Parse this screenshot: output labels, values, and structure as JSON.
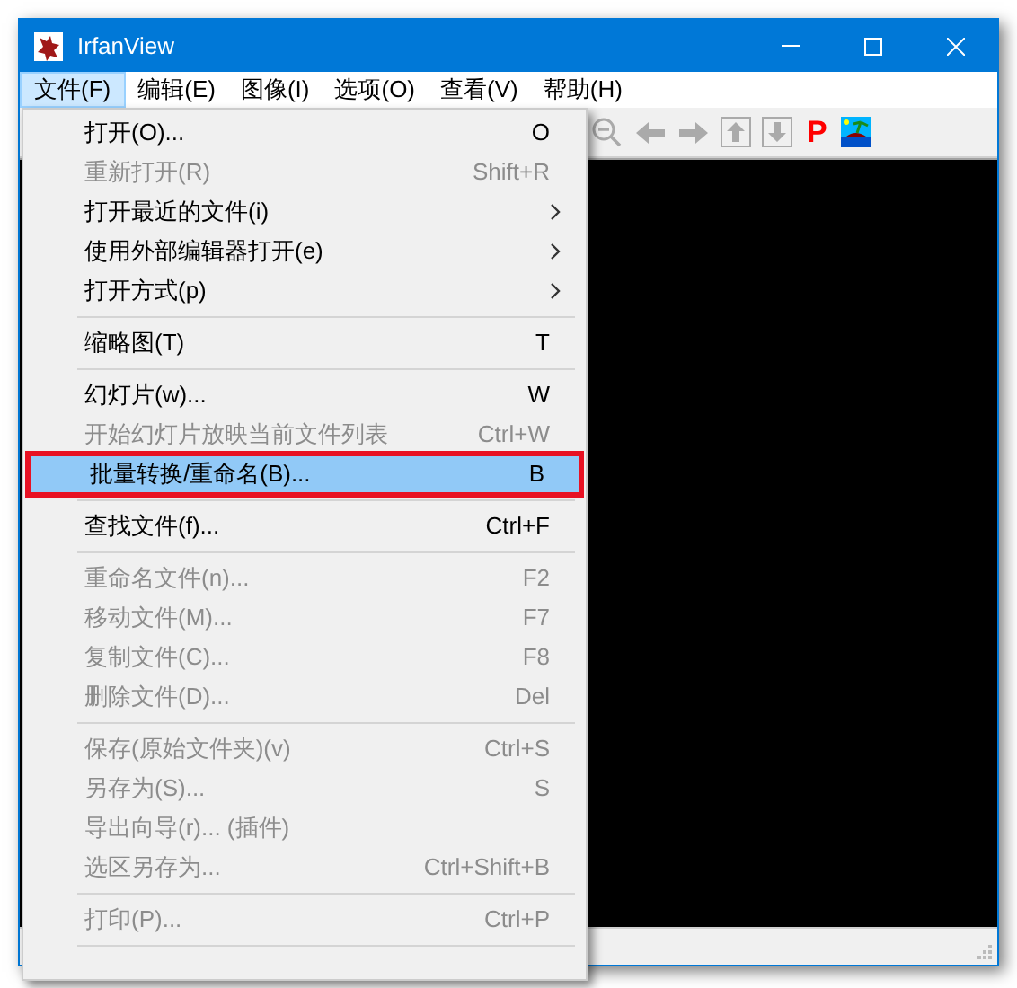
{
  "window": {
    "title": "IrfanView"
  },
  "menubar": [
    {
      "label": "文件(F)",
      "selected": true
    },
    {
      "label": "编辑(E)",
      "selected": false
    },
    {
      "label": "图像(I)",
      "selected": false
    },
    {
      "label": "选项(O)",
      "selected": false
    },
    {
      "label": "查看(V)",
      "selected": false
    },
    {
      "label": "帮助(H)",
      "selected": false
    }
  ],
  "menu": [
    {
      "kind": "item",
      "label": "打开(O)...",
      "shortcut": "O",
      "disabled": false,
      "submenu": false,
      "selected": false,
      "annotated": false
    },
    {
      "kind": "item",
      "label": "重新打开(R)",
      "shortcut": "Shift+R",
      "disabled": true,
      "submenu": false,
      "selected": false,
      "annotated": false
    },
    {
      "kind": "item",
      "label": "打开最近的文件(i)",
      "disabled": false,
      "submenu": true,
      "selected": false,
      "annotated": false
    },
    {
      "kind": "item",
      "label": "使用外部编辑器打开(e)",
      "disabled": false,
      "submenu": true,
      "selected": false,
      "annotated": false
    },
    {
      "kind": "item",
      "label": "打开方式(p)",
      "disabled": false,
      "submenu": true,
      "selected": false,
      "annotated": false
    },
    {
      "kind": "separator"
    },
    {
      "kind": "item",
      "label": "缩略图(T)",
      "shortcut": "T",
      "disabled": false,
      "submenu": false,
      "selected": false,
      "annotated": false
    },
    {
      "kind": "separator"
    },
    {
      "kind": "item",
      "label": "幻灯片(w)...",
      "shortcut": "W",
      "disabled": false,
      "submenu": false,
      "selected": false,
      "annotated": false
    },
    {
      "kind": "item",
      "label": "开始幻灯片放映当前文件列表",
      "shortcut": "Ctrl+W",
      "disabled": true,
      "submenu": false,
      "selected": false,
      "annotated": false
    },
    {
      "kind": "item",
      "label": "批量转换/重命名(B)...",
      "shortcut": "B",
      "disabled": false,
      "submenu": false,
      "selected": true,
      "annotated": true
    },
    {
      "kind": "separator"
    },
    {
      "kind": "item",
      "label": "查找文件(f)...",
      "shortcut": "Ctrl+F",
      "disabled": false,
      "submenu": false,
      "selected": false,
      "annotated": false
    },
    {
      "kind": "separator"
    },
    {
      "kind": "item",
      "label": "重命名文件(n)...",
      "shortcut": "F2",
      "disabled": true,
      "submenu": false,
      "selected": false,
      "annotated": false
    },
    {
      "kind": "item",
      "label": "移动文件(M)...",
      "shortcut": "F7",
      "disabled": true,
      "submenu": false,
      "selected": false,
      "annotated": false
    },
    {
      "kind": "item",
      "label": "复制文件(C)...",
      "shortcut": "F8",
      "disabled": true,
      "submenu": false,
      "selected": false,
      "annotated": false
    },
    {
      "kind": "item",
      "label": "删除文件(D)...",
      "shortcut": "Del",
      "disabled": true,
      "submenu": false,
      "selected": false,
      "annotated": false
    },
    {
      "kind": "separator"
    },
    {
      "kind": "item",
      "label": "保存(原始文件夹)(v)",
      "shortcut": "Ctrl+S",
      "disabled": true,
      "submenu": false,
      "selected": false,
      "annotated": false
    },
    {
      "kind": "item",
      "label": "另存为(S)...",
      "shortcut": "S",
      "disabled": true,
      "submenu": false,
      "selected": false,
      "annotated": false
    },
    {
      "kind": "item",
      "label": "导出向导(r)... (插件)",
      "disabled": true,
      "submenu": false,
      "selected": false,
      "annotated": false
    },
    {
      "kind": "item",
      "label": "选区另存为...",
      "shortcut": "Ctrl+Shift+B",
      "disabled": true,
      "submenu": false,
      "selected": false,
      "annotated": false
    },
    {
      "kind": "separator"
    },
    {
      "kind": "item",
      "label": "打印(P)...",
      "shortcut": "Ctrl+P",
      "disabled": true,
      "submenu": false,
      "selected": false,
      "annotated": false
    },
    {
      "kind": "separator"
    }
  ],
  "toolbar": {
    "letter_button": "P"
  }
}
